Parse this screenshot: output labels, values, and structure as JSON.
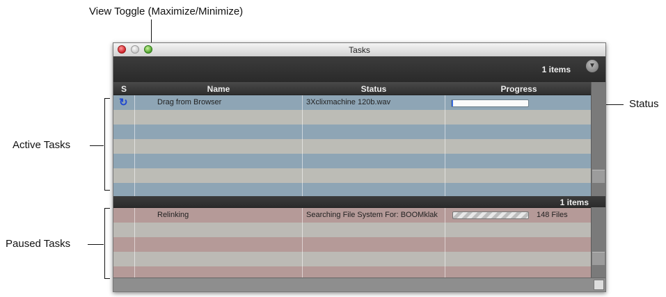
{
  "annotations": {
    "view_toggle": "View Toggle (Maximize/Minimize)",
    "status": "Status",
    "active_tasks": "Active Tasks",
    "paused_tasks": "Paused Tasks"
  },
  "window": {
    "title": "Tasks",
    "top_count": "1 items",
    "paused_count": "1 items",
    "menu_icon": "chevron-down-icon"
  },
  "columns": {
    "s": "S",
    "name": "Name",
    "status": "Status",
    "progress": "Progress"
  },
  "active_tasks": [
    {
      "icon": "sync-icon",
      "name": "Drag from Browser",
      "status": "3Xclixmachine 120b.wav",
      "progress": 0.02
    }
  ],
  "paused_tasks": [
    {
      "name": "Relinking",
      "status": "Searching File System For: BOOMklak",
      "progress_text": "148 Files"
    }
  ],
  "colors": {
    "active_dark": "#8ea5b5",
    "active_light": "#bcbcb6",
    "paused_dark": "#b59a98",
    "paused_light": "#bcbab5"
  }
}
